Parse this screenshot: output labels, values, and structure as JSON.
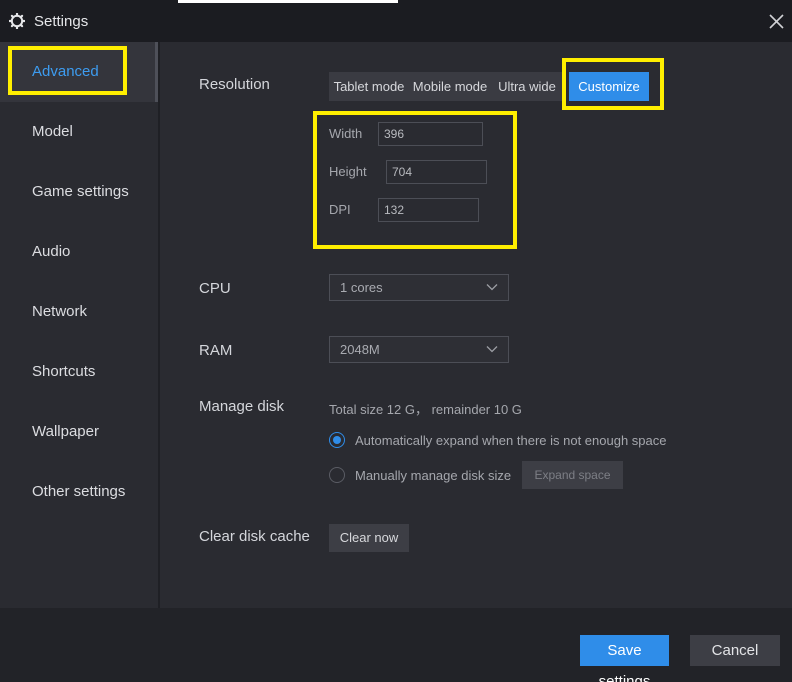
{
  "window": {
    "title": "Settings",
    "icon": "gear-icon",
    "close_icon": "close-icon"
  },
  "sidebar": {
    "items": [
      {
        "label": "Advanced",
        "active": true
      },
      {
        "label": "Model"
      },
      {
        "label": "Game settings"
      },
      {
        "label": "Audio"
      },
      {
        "label": "Network"
      },
      {
        "label": "Shortcuts"
      },
      {
        "label": "Wallpaper"
      },
      {
        "label": "Other settings"
      }
    ]
  },
  "resolution": {
    "label": "Resolution",
    "modes": [
      "Tablet mode",
      "Mobile mode",
      "Ultra wide",
      "Customize"
    ],
    "selected": "Customize",
    "width": {
      "label": "Width",
      "value": "396"
    },
    "height": {
      "label": "Height",
      "value": "704"
    },
    "dpi": {
      "label": "DPI",
      "value": "132"
    }
  },
  "cpu": {
    "label": "CPU",
    "value": "1 cores"
  },
  "ram": {
    "label": "RAM",
    "value": "2048M"
  },
  "disk": {
    "label": "Manage disk",
    "info": "Total size 12 G， remainder 10 G",
    "option_auto": "Automatically expand when there is not enough space",
    "option_manual": "Manually manage disk size",
    "expand_button": "Expand space",
    "selected": "auto"
  },
  "cache": {
    "label": "Clear disk cache",
    "button": "Clear now"
  },
  "footer": {
    "save": "Save settings",
    "cancel": "Cancel"
  },
  "colors": {
    "accent": "#2f8de9",
    "highlight": "#ffef00",
    "background": "#2a2b31",
    "titlebar": "#1b1c21"
  }
}
